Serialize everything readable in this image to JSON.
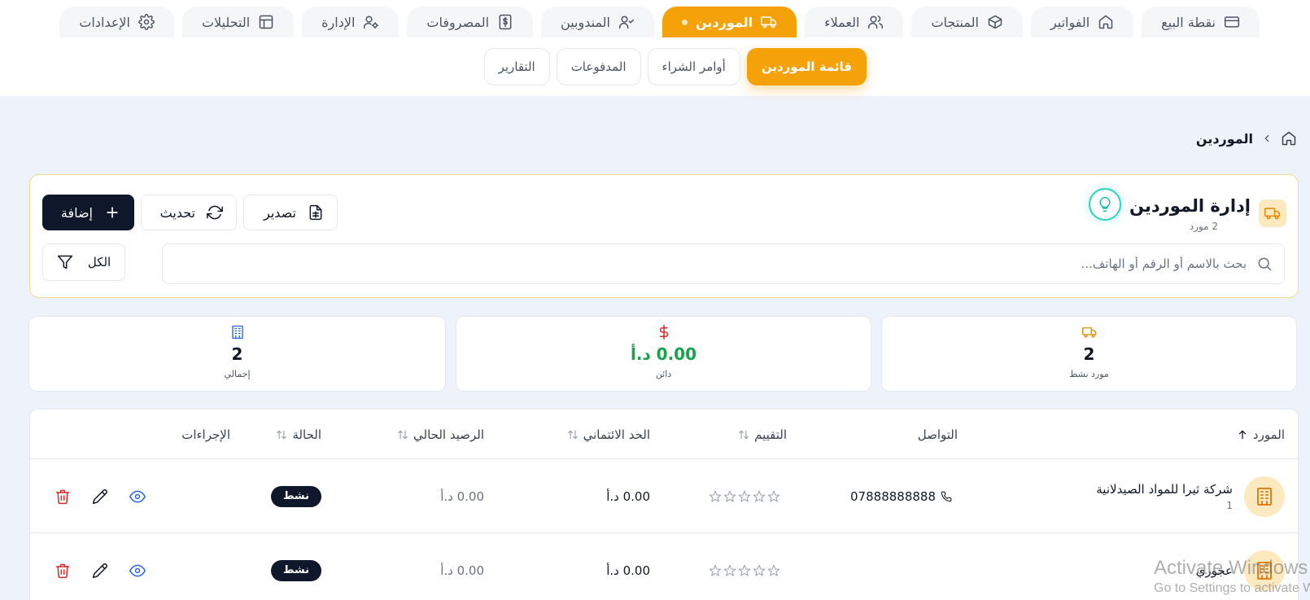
{
  "nav": {
    "tabs": [
      {
        "label": "نقطة البيع",
        "icon": "credit-card-icon"
      },
      {
        "label": "الفواتير",
        "icon": "home-icon"
      },
      {
        "label": "المنتجات",
        "icon": "box-icon"
      },
      {
        "label": "العملاء",
        "icon": "users-icon"
      },
      {
        "label": "الموردين",
        "icon": "truck-icon",
        "active": true
      },
      {
        "label": "المندوبين",
        "icon": "user-check-icon"
      },
      {
        "label": "المصروفات",
        "icon": "dollar-receipt-icon"
      },
      {
        "label": "الإدارة",
        "icon": "user-cog-icon"
      },
      {
        "label": "التحليلات",
        "icon": "layout-icon"
      },
      {
        "label": "الإعدادات",
        "icon": "gear-icon"
      }
    ]
  },
  "subnav": {
    "tabs": [
      {
        "label": "قائمة الموردين",
        "active": true
      },
      {
        "label": "أوامر الشراء"
      },
      {
        "label": "المدفوعات"
      },
      {
        "label": "التقارير"
      }
    ]
  },
  "breadcrumb": {
    "current": "الموردين"
  },
  "header": {
    "title": "إدارة الموردين",
    "subtitle": "2 مورد",
    "add_label": "إضافة",
    "refresh_label": "تحديث",
    "export_label": "تصدير",
    "search_placeholder": "بحث بالاسم أو الرقم أو الهاتف...",
    "search_value": "",
    "filter_label": "الكل"
  },
  "stats": [
    {
      "value": "2",
      "label": "مورد نشط",
      "icon": "truck-icon",
      "color": "#e08a00"
    },
    {
      "value": "0.00 د.أ",
      "label": "دائن",
      "icon": "dollar-icon",
      "color": "#dc2626",
      "value_color": "#16a34a"
    },
    {
      "value": "2",
      "label": "إجمالي",
      "icon": "building-icon",
      "color": "#2563eb"
    }
  ],
  "table": {
    "columns": {
      "supplier": "المورد",
      "contact": "التواصل",
      "rating": "التقييم",
      "credit_limit": "الحد الائتماني",
      "balance": "الرصيد الحالي",
      "status": "الحالة",
      "actions": "الإجراءات"
    },
    "rows": [
      {
        "name": "شركة ثيرا للمواد الصيدلانية",
        "code": "1",
        "phone": "07888888888",
        "rating": 0,
        "credit_limit": "0.00 د.أ",
        "balance": "0.00 د.أ",
        "status": "نشط"
      },
      {
        "name": "عجوري",
        "code": "",
        "phone": "",
        "rating": 0,
        "credit_limit": "0.00 د.أ",
        "balance": "0.00 د.أ",
        "status": "نشط"
      }
    ]
  },
  "watermark": {
    "title": "Activate Windows",
    "subtitle": "Go to Settings to activate Windows."
  },
  "colors": {
    "accent": "#f5a20a",
    "primary_button": "#0f172a",
    "positive": "#16a34a",
    "danger": "#dc2626",
    "link": "#2563eb"
  }
}
